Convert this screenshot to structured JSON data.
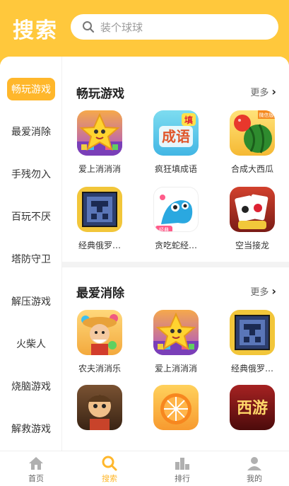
{
  "header": {
    "title": "搜索",
    "search_placeholder": "装个球球"
  },
  "sidebar": {
    "items": [
      {
        "label": "畅玩游戏",
        "active": true
      },
      {
        "label": "最爱消除"
      },
      {
        "label": "手残勿入"
      },
      {
        "label": "百玩不厌"
      },
      {
        "label": "塔防守卫"
      },
      {
        "label": "解压游戏"
      },
      {
        "label": "火柴人"
      },
      {
        "label": "烧脑游戏"
      },
      {
        "label": "解救游戏"
      }
    ]
  },
  "sections": [
    {
      "title": "畅玩游戏",
      "more": "更多",
      "games": [
        {
          "name": "爱上消消消",
          "icon": "star-icon"
        },
        {
          "name": "疯狂填成语",
          "icon": "chengyu-icon"
        },
        {
          "name": "合成大西瓜",
          "icon": "watermelon-icon"
        },
        {
          "name": "经典俄罗…",
          "icon": "tetris-icon"
        },
        {
          "name": "贪吃蛇经…",
          "icon": "snake-icon"
        },
        {
          "name": "空当接龙",
          "icon": "cards-icon"
        }
      ]
    },
    {
      "title": "最爱消除",
      "more": "更多",
      "games": [
        {
          "name": "农夫消消乐",
          "icon": "farmer-icon"
        },
        {
          "name": "爱上消消消",
          "icon": "star-icon"
        },
        {
          "name": "经典俄罗…",
          "icon": "tetris-icon"
        },
        {
          "name": "",
          "icon": "boy-icon"
        },
        {
          "name": "",
          "icon": "orange-icon"
        },
        {
          "name": "",
          "icon": "journey-icon"
        }
      ]
    }
  ],
  "icon_text": {
    "chengyu": "成语",
    "chengyu_badge": "填",
    "journey": "西游",
    "melon_tag": "微信版",
    "snake_tag": "经典"
  },
  "bottom_nav": [
    {
      "label": "首页",
      "icon": "home-icon"
    },
    {
      "label": "搜索",
      "icon": "search-icon",
      "active": true
    },
    {
      "label": "排行",
      "icon": "ranking-icon"
    },
    {
      "label": "我的",
      "icon": "profile-icon"
    }
  ],
  "colors": {
    "accent": "#ffc83c",
    "active": "#ffb72b"
  }
}
